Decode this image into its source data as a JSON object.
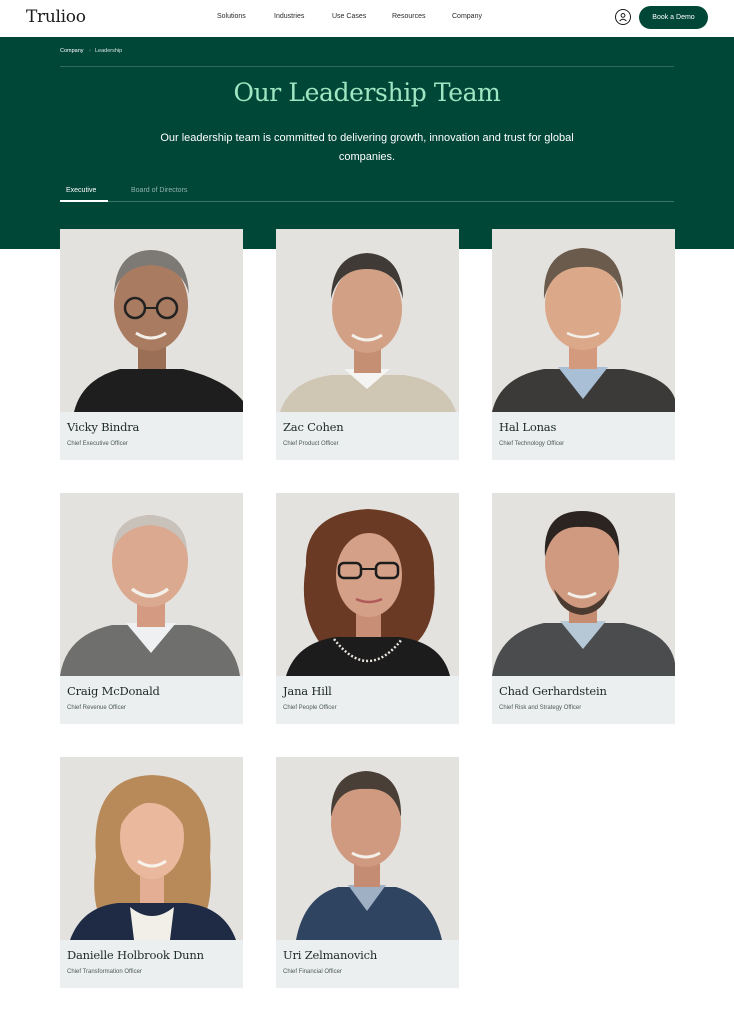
{
  "header": {
    "logo": "Trulioo",
    "nav": [
      "Solutions",
      "Industries",
      "Use Cases",
      "Resources",
      "Company"
    ],
    "account_icon": "user-circle-icon",
    "cta": "Book a Demo"
  },
  "breadcrumb": [
    "Company",
    "Leadership"
  ],
  "hero": {
    "title": "Our Leadership Team",
    "subtitle": "Our leadership team is committed to delivering growth, innovation and trust for global companies."
  },
  "tabs": [
    {
      "label": "Executive",
      "active": true
    },
    {
      "label": "Board of Directors",
      "active": false
    }
  ],
  "people": [
    {
      "name": "Vicky Bindra",
      "role": "Chief Executive Officer"
    },
    {
      "name": "Zac Cohen",
      "role": "Chief Product Officer"
    },
    {
      "name": "Hal Lonas",
      "role": "Chief Technology Officer"
    },
    {
      "name": "Craig McDonald",
      "role": "Chief Revenue Officer"
    },
    {
      "name": "Jana Hill",
      "role": "Chief People Officer"
    },
    {
      "name": "Chad Gerhardstein",
      "role": "Chief Risk and Strategy Officer"
    },
    {
      "name": "Danielle Holbrook Dunn",
      "role": "Chief Transformation Officer"
    },
    {
      "name": "Uri Zelmanovich",
      "role": "Chief Financial Officer"
    }
  ],
  "colors": {
    "brand_green": "#014738",
    "title_mint": "#9fe6c2",
    "card_caption_bg": "#ebeff0",
    "photo_bg": "#e4e2de"
  }
}
